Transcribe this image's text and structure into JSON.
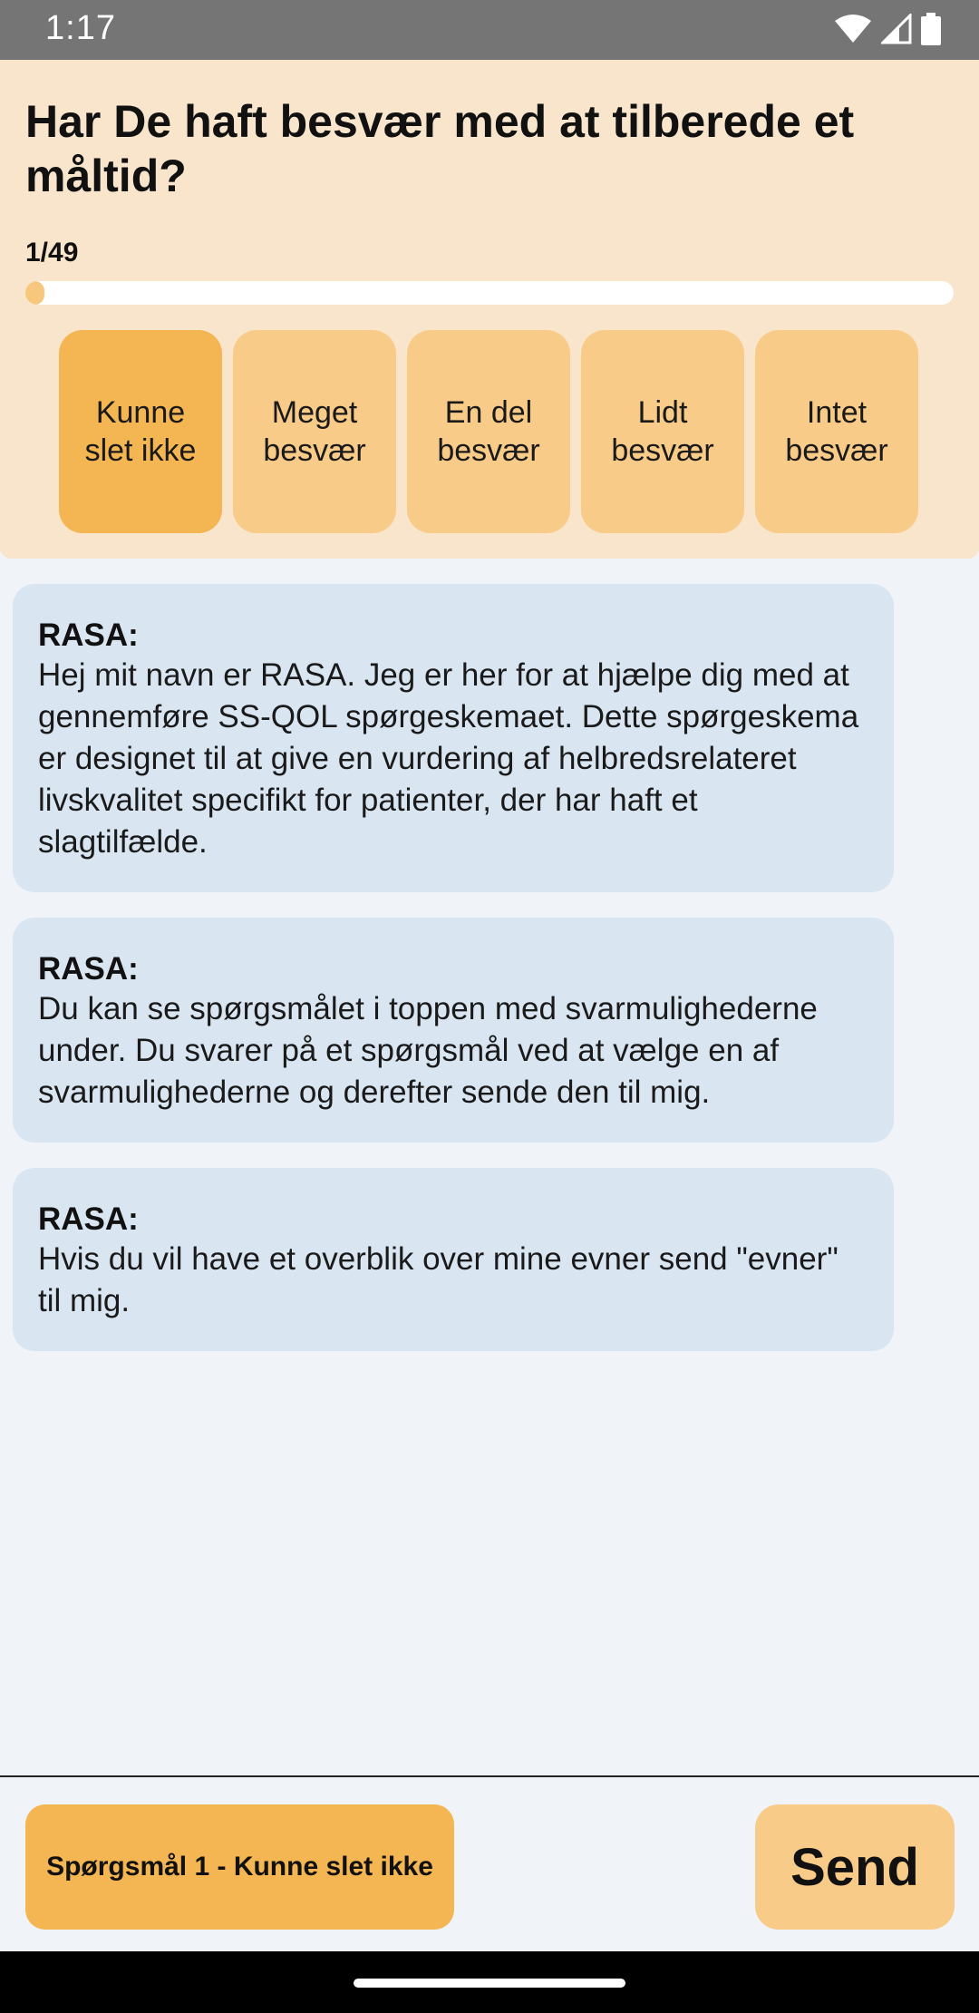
{
  "status_bar": {
    "time": "1:17",
    "icons": [
      "wifi-icon",
      "signal-icon",
      "battery-icon"
    ]
  },
  "question": {
    "text": "Har De haft besvær med at tilberede et måltid?",
    "progress_label": "1/49",
    "progress_fraction": 0.0204
  },
  "options": [
    {
      "label": "Kunne slet ikke",
      "selected": true
    },
    {
      "label": "Meget besvær",
      "selected": false
    },
    {
      "label": "En del besvær",
      "selected": false
    },
    {
      "label": "Lidt besvær",
      "selected": false
    },
    {
      "label": "Intet besvær",
      "selected": false
    }
  ],
  "messages": [
    {
      "sender": "RASA:",
      "text": "Hej mit navn er RASA. Jeg er her for at hjælpe dig med at gennemføre SS-QOL spørgeskemaet. Dette spørgeskema er designet til at give en vurdering af helbredsrelateret livskvalitet specifikt for patienter, der har haft et slagtilfælde."
    },
    {
      "sender": "RASA:",
      "text": "Du kan se spørgsmålet i toppen med svarmulighederne under. Du svarer på et spørgsmål ved at vælge en af svarmulighederne og derefter sende den til mig."
    },
    {
      "sender": "RASA:",
      "text": "Hvis du vil have et overblik over mine evner send \"evner\" til mig."
    }
  ],
  "composer": {
    "reply_label": "Spørgsmål 1 - Kunne slet ikke",
    "send_label": "Send"
  },
  "colors": {
    "header_bg": "#f8e5cc",
    "option_bg": "#f9cb88",
    "option_selected_bg": "#f4b553",
    "bubble_bg": "#d9e6f2",
    "background": "#f0f4f8"
  }
}
